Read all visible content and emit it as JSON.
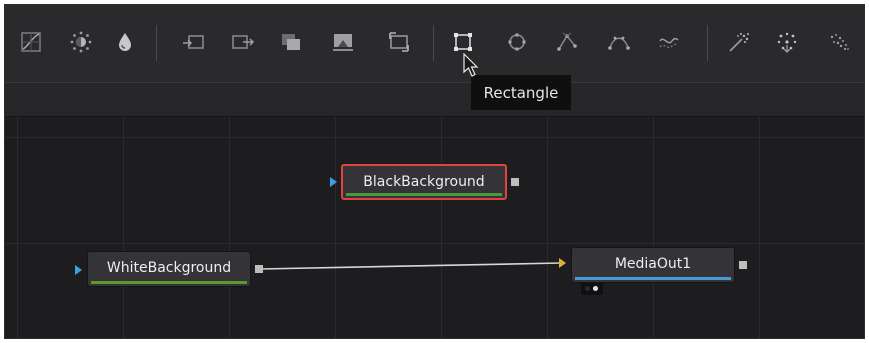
{
  "toolbar": {
    "tools": [
      {
        "icon": "curves-icon"
      },
      {
        "icon": "brightness-contrast-icon"
      },
      {
        "icon": "color-corrector-icon"
      },
      {
        "icon": "loader-icon"
      },
      {
        "icon": "saver-icon"
      },
      {
        "icon": "merge-icon"
      },
      {
        "icon": "matte-control-icon"
      },
      {
        "icon": "transform-icon"
      },
      {
        "icon": "rectangle-icon"
      },
      {
        "icon": "ellipse-icon"
      },
      {
        "icon": "polygon-icon"
      },
      {
        "icon": "bspline-icon"
      },
      {
        "icon": "paint-icon"
      },
      {
        "icon": "particles-emitter-icon"
      },
      {
        "icon": "particles-render-icon"
      },
      {
        "icon": "particles-merge-icon"
      }
    ],
    "active_tool": "rectangle-icon",
    "tooltip": "Rectangle"
  },
  "nodes": {
    "black_background": {
      "label": "BlackBackground",
      "selected": true,
      "bar_color": "#4a9a3a",
      "border_color": "#e0443a"
    },
    "white_background": {
      "label": "WhiteBackground",
      "bar_color": "#5a9a30"
    },
    "media_out": {
      "label": "MediaOut1",
      "bar_color": "#4a9ad8"
    }
  },
  "colors": {
    "input_arrow": "#3aa0e0",
    "media_input_arrow": "#e0b030",
    "connection": "#d8d8d8"
  }
}
